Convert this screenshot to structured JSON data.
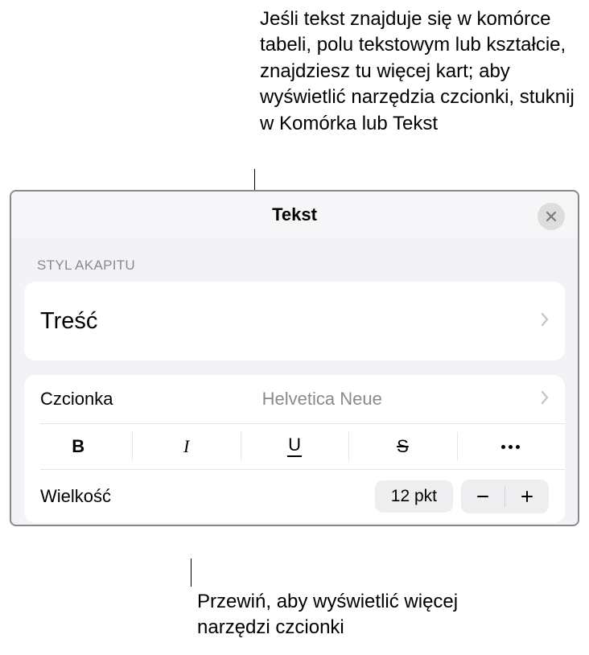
{
  "callouts": {
    "top": "Jeśli tekst znajduje się w komórce tabeli, polu tekstowym lub kształcie, znajdziesz tu więcej kart; aby wyświetlić narzędzia czcionki, stuknij w Komórka lub Tekst",
    "bottom": "Przewiń, aby wyświetlić więcej narzędzi czcionki"
  },
  "panel": {
    "title": "Tekst",
    "section_paragraph_label": "STYL AKAPITU",
    "paragraph_style": "Treść",
    "font": {
      "label": "Czcionka",
      "value": "Helvetica Neue"
    },
    "styles": {
      "bold": "B",
      "italic": "I",
      "underline": "U",
      "strike": "S"
    },
    "size": {
      "label": "Wielkość",
      "value": "12 pkt"
    }
  }
}
